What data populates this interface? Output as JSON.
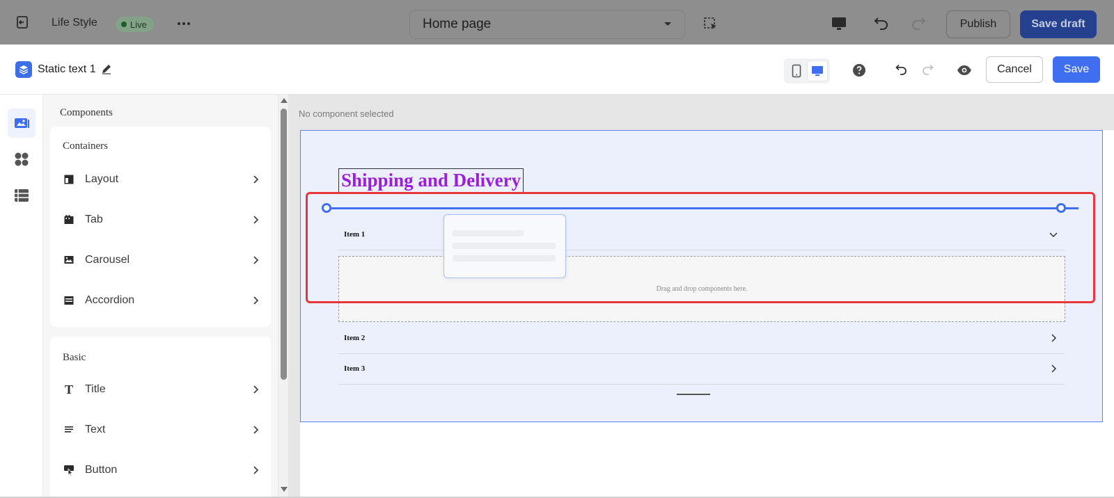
{
  "topbar": {
    "app_name": "Life Style",
    "live_badge": "Live",
    "page_select": "Home page",
    "publish_label": "Publish",
    "save_draft_label": "Save draft"
  },
  "editor_header": {
    "component_name": "Static text 1",
    "cancel_label": "Cancel",
    "save_label": "Save",
    "accent_color": "#3f6ef0"
  },
  "panel": {
    "title": "Components",
    "groups": [
      {
        "title": "Containers",
        "items": [
          {
            "label": "Layout",
            "icon": "layout-icon"
          },
          {
            "label": "Tab",
            "icon": "tab-icon"
          },
          {
            "label": "Carousel",
            "icon": "carousel-icon"
          },
          {
            "label": "Accordion",
            "icon": "accordion-icon"
          }
        ]
      },
      {
        "title": "Basic",
        "items": [
          {
            "label": "Title",
            "icon": "title-icon"
          },
          {
            "label": "Text",
            "icon": "text-icon"
          },
          {
            "label": "Button",
            "icon": "button-icon"
          }
        ]
      }
    ]
  },
  "canvas": {
    "status": "No component selected",
    "heading": "Shipping and Delivery",
    "heading_color": "#9c1ddc",
    "accordion_items": [
      "Item 1",
      "Item 2",
      "Item 3"
    ],
    "dropzone_text": "Drag and drop components here.",
    "highlight_color": "#e8363a"
  }
}
